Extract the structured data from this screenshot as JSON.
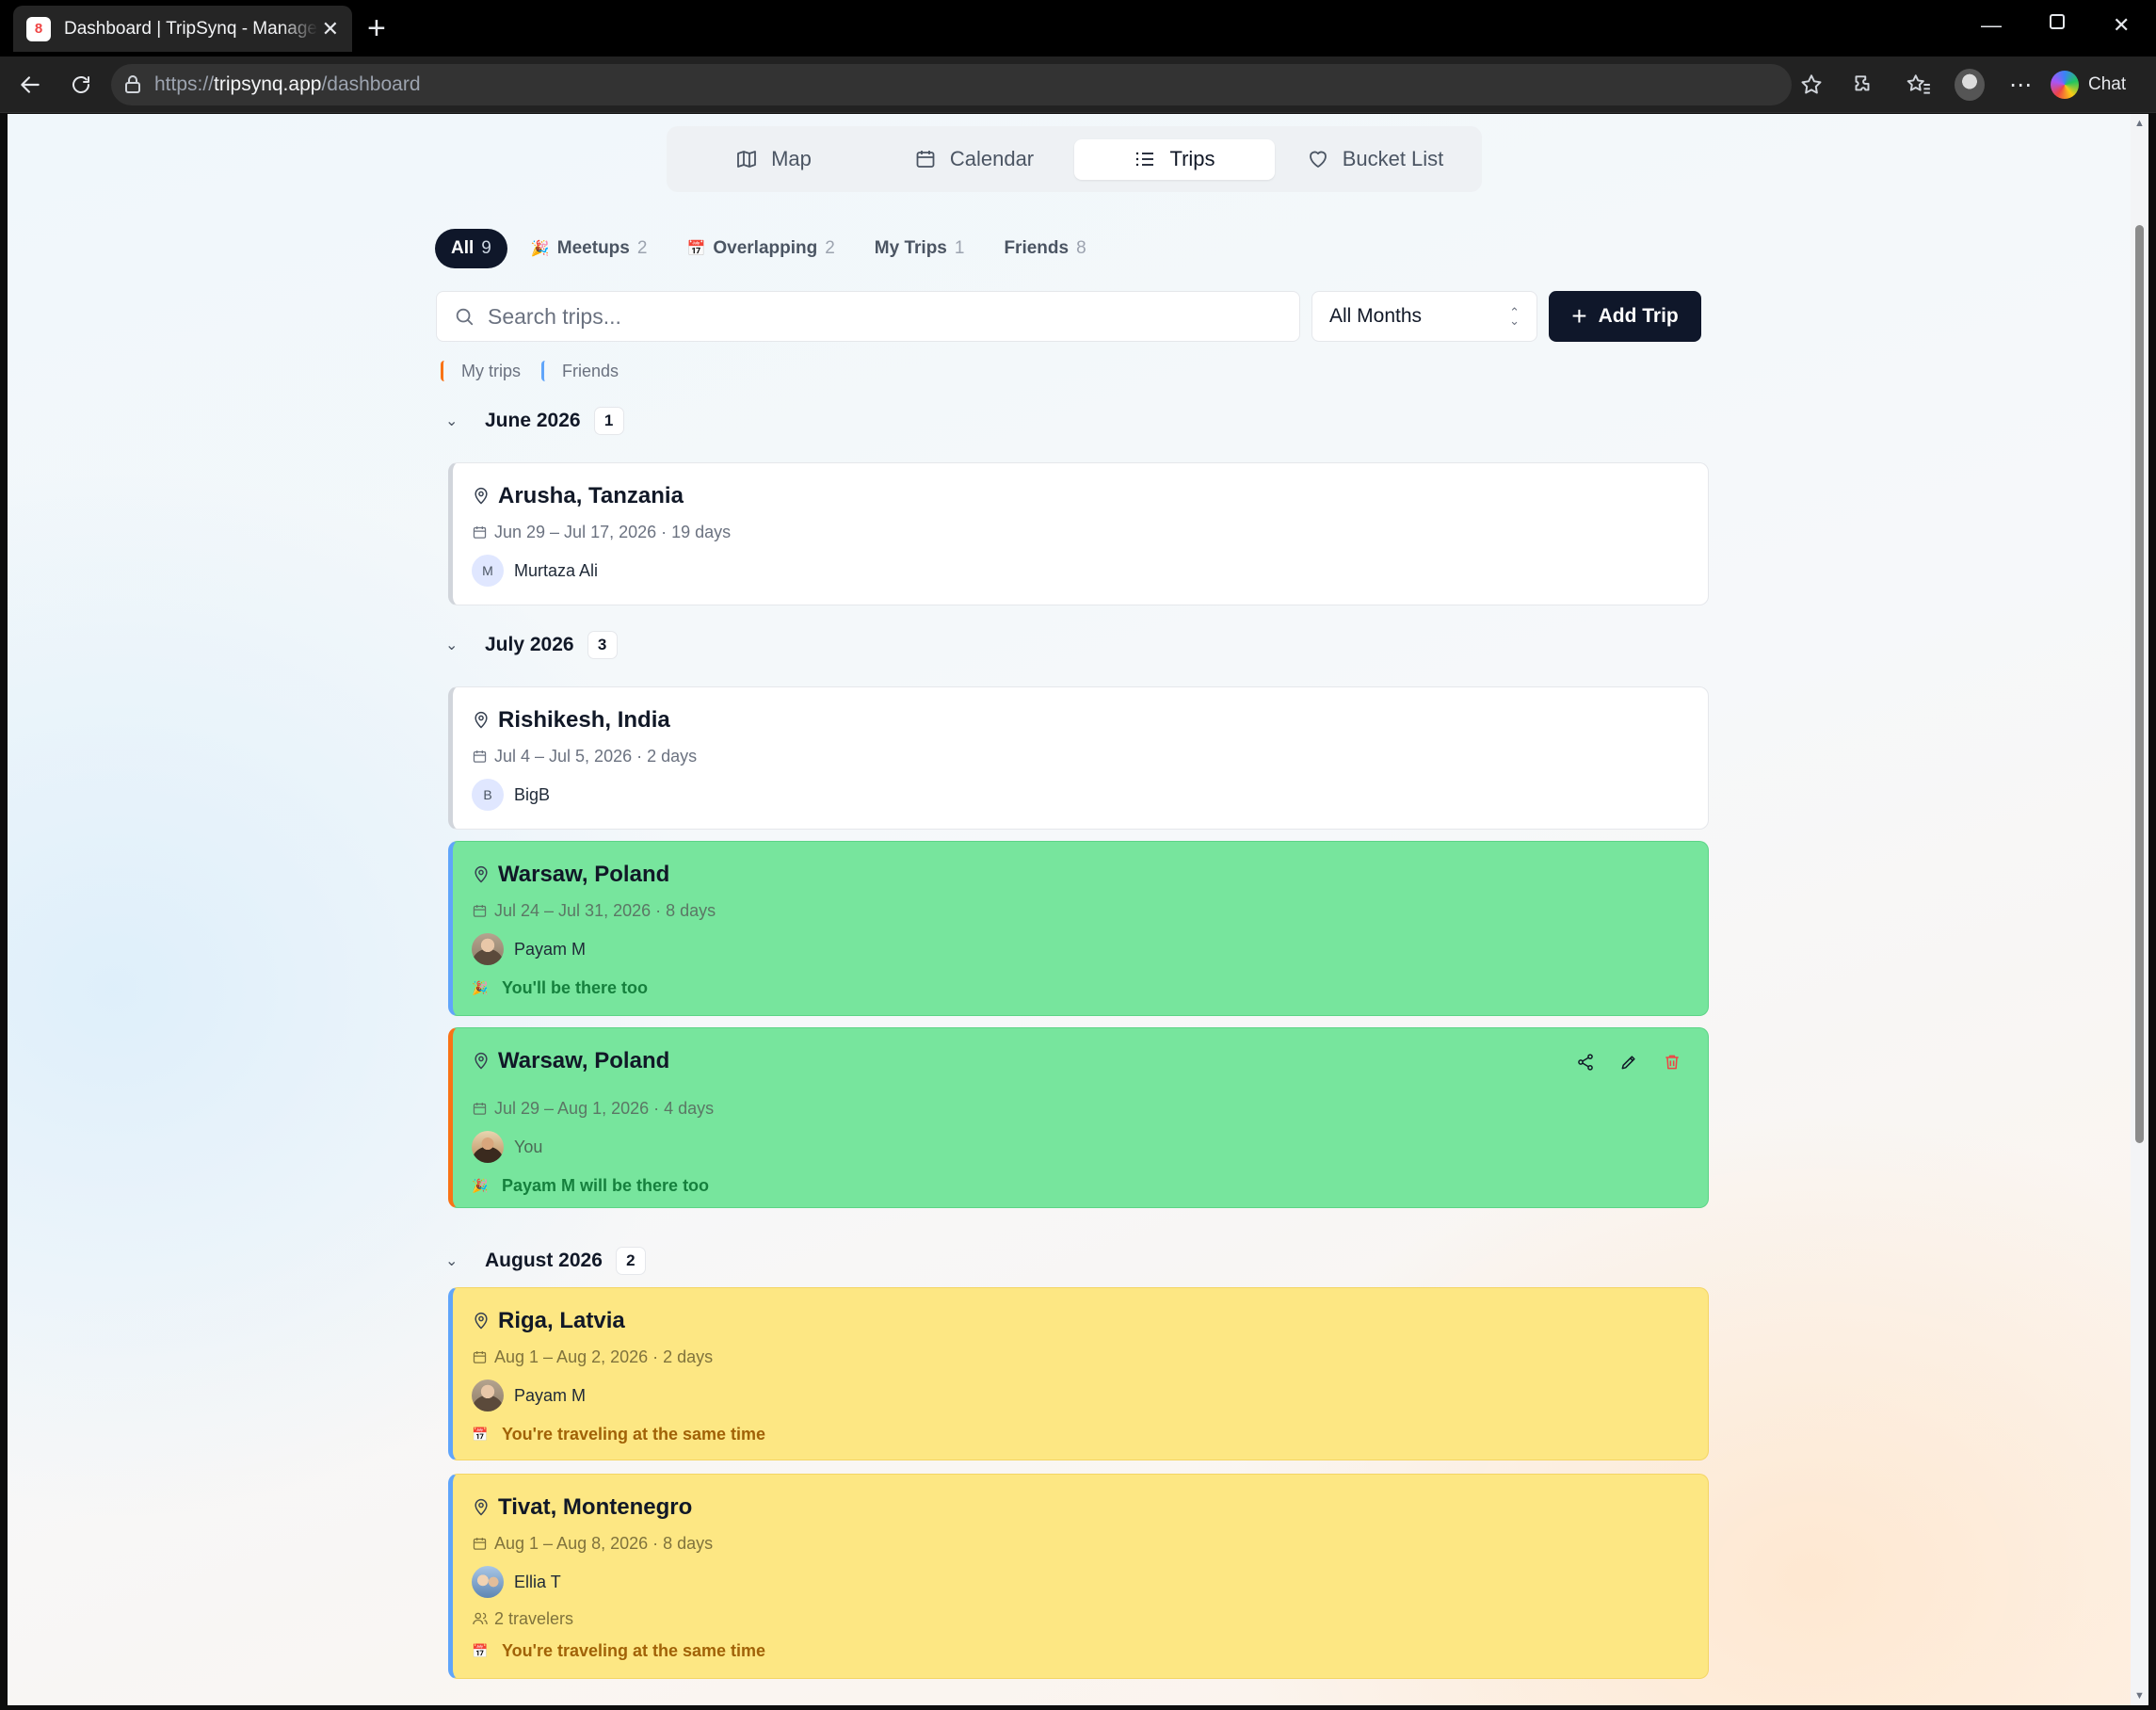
{
  "browser": {
    "tab_title": "Dashboard | TripSynq - Manage Your Trips",
    "tab_favicon": "8",
    "url_prefix": "https://",
    "url_host": "tripsynq.app",
    "url_path": "/dashboard",
    "chat_label": "Chat"
  },
  "view_tabs": [
    {
      "label": "Map",
      "icon": "map-icon"
    },
    {
      "label": "Calendar",
      "icon": "calendar-icon"
    },
    {
      "label": "Trips",
      "icon": "list-icon",
      "active": true
    },
    {
      "label": "Bucket List",
      "icon": "heart-icon"
    }
  ],
  "filters": [
    {
      "label": "All",
      "count": "9",
      "active": true
    },
    {
      "label": "Meetups",
      "count": "2",
      "emoji": "🎉"
    },
    {
      "label": "Overlapping",
      "count": "2",
      "emoji": "📅"
    },
    {
      "label": "My Trips",
      "count": "1"
    },
    {
      "label": "Friends",
      "count": "8"
    }
  ],
  "search": {
    "placeholder": "Search trips..."
  },
  "month_select": {
    "value": "All Months"
  },
  "add_trip_label": "Add Trip",
  "legend": {
    "mine": "My trips",
    "friends": "Friends"
  },
  "colors": {
    "mine": "#f97316",
    "friends": "#60a5fa",
    "meetup": "#77e59d",
    "overlap": "#fde783"
  },
  "groups": [
    {
      "month": "June 2026",
      "count": "1",
      "trips": [
        {
          "location": "Arusha, Tanzania",
          "dates": "Jun 29 – Jul 17, 2026 · 19 days",
          "owner": "Murtaza Ali",
          "initial": "M",
          "style": "white"
        }
      ]
    },
    {
      "month": "July 2026",
      "count": "3",
      "trips": [
        {
          "location": "Rishikesh, India",
          "dates": "Jul 4 – Jul 5, 2026 · 2 days",
          "owner": "BigB",
          "initial": "B",
          "style": "white"
        },
        {
          "location": "Warsaw, Poland",
          "dates": "Jul 24 – Jul 31, 2026 · 8 days",
          "owner": "Payam M",
          "note": "You'll be there too",
          "style": "green"
        },
        {
          "location": "Warsaw, Poland",
          "dates": "Jul 29 – Aug 1, 2026 · 4 days",
          "owner": "You",
          "note": "Payam M will be there too",
          "style": "green-mine"
        }
      ]
    },
    {
      "month": "August 2026",
      "count": "2",
      "trips": [
        {
          "location": "Riga, Latvia",
          "dates": "Aug 1 – Aug 2, 2026 · 2 days",
          "owner": "Payam M",
          "note": "You're traveling at the same time",
          "style": "yellow"
        },
        {
          "location": "Tivat, Montenegro",
          "dates": "Aug 1 – Aug 8, 2026 · 8 days",
          "owner": "Ellia T",
          "travelers": "2 travelers",
          "note": "You're traveling at the same time",
          "style": "yellow"
        }
      ]
    }
  ]
}
